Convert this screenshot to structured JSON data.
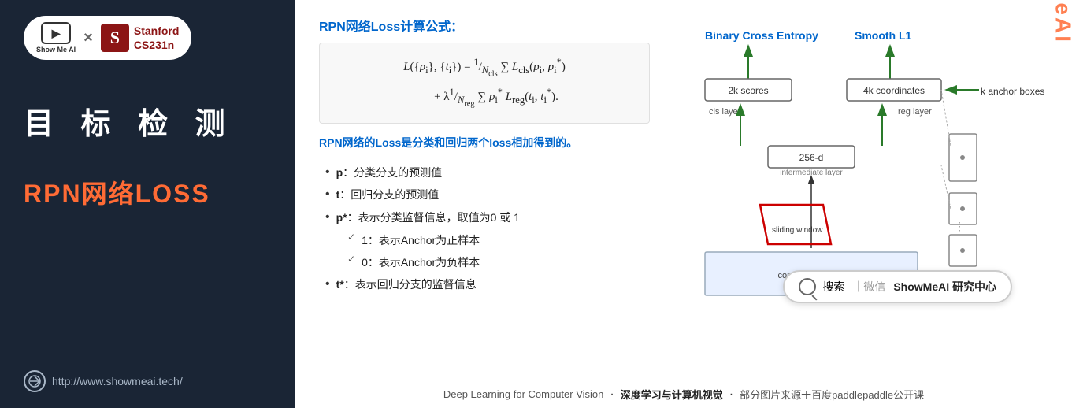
{
  "sidebar": {
    "logo": {
      "showmeai_label": "Show Me AI",
      "icon_symbol": "▶",
      "x_separator": "×",
      "stanford_letter": "S",
      "stanford_name": "Stanford",
      "stanford_course": "CS231n"
    },
    "title_chinese": "目 标 检 测",
    "section_title": "RPN网络LOSS",
    "website": "http://www.showmeai.tech/"
  },
  "main": {
    "formula_heading": "RPN网络Loss计算公式：",
    "formula_line1": "L({pᵢ}, {tᵢ}) = (1/Nₓₗₛ) Σ Lₓₗₛ(pᵢ, pᵢ*)",
    "formula_line2": "+ λ(1/Nᵣₑg) Σ pᵢ* Lᵣₑg(tᵢ, tᵢ*)",
    "desc_blue": "RPN网络的Loss是分类和回归两个loss相加得到的。",
    "bullets": [
      "p：分类分支的预测值",
      "t：回归分支的预测值",
      "p*：表示分类监督信息，取值为0 或 1",
      "1：表示Anchor为正样本",
      "0：表示Anchor为负样本",
      "t*：表示回归分支的监督信息"
    ],
    "diagram_labels": {
      "binary_cross_entropy": "Binary Cross Entropy",
      "smooth_l1": "Smooth L1",
      "cls_layer": "cls layer",
      "reg_layer": "reg layer",
      "scores_label": "2k scores",
      "coords_label": "4k coordinates",
      "anchor_label": "k anchor boxes",
      "dim_256": "256-d",
      "intermediate": "intermediate layer",
      "sliding_window": "sliding window",
      "conv_feature": "conv feature map"
    },
    "search_bar": {
      "icon": "🔍",
      "text": "搜索",
      "divider": "｜微信",
      "bold_text": "ShowMeAI 研究中心"
    },
    "watermark": "ShowMeAI"
  },
  "footer": {
    "text1": "Deep Learning for Computer Vision",
    "dot": "·",
    "text2": "深度学习与计算机视觉",
    "dot2": "·",
    "text3": "部分图片来源于百度paddlepaddle公开课"
  }
}
